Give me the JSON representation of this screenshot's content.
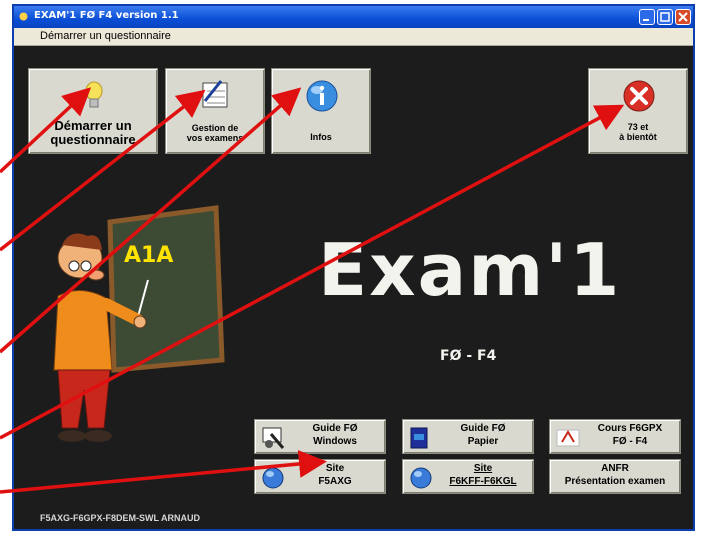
{
  "window": {
    "title": "EXAM'1 FØ F4 version 1.1"
  },
  "menu": {
    "items": [
      "Démarrer un questionnaire"
    ]
  },
  "top_buttons": {
    "start": "Démarrer un\nquestionnaire",
    "manage": "Gestion de\nvos examens",
    "infos": "Infos",
    "quit": "73 et\nà bientôt"
  },
  "board": {
    "text": "A1A"
  },
  "main": {
    "title": "Exam'1",
    "subtitle": "FØ - F4"
  },
  "bottom_buttons": {
    "guide_windows": "Guide FØ\nWindows",
    "guide_paper": "Guide FØ\nPapier",
    "cours": "Cours F6GPX\nFØ - F4",
    "site_f5axg": "Site\nF5AXG",
    "site_f6kff": "Site\nF6KFF-F6KGL",
    "anfr": "ANFR\nPrésentation examen"
  },
  "footer": {
    "credits": "F5AXG-F6GPX-F8DEM-SWL ARNAUD"
  },
  "colors": {
    "arrow": "#e01010",
    "background": "#1c1c1c",
    "titlebar": "#0a4fd6"
  },
  "icons": {
    "start": "lightbulb-icon",
    "manage": "checklist-icon",
    "infos": "info-globe-icon",
    "quit": "close-circle-icon"
  }
}
